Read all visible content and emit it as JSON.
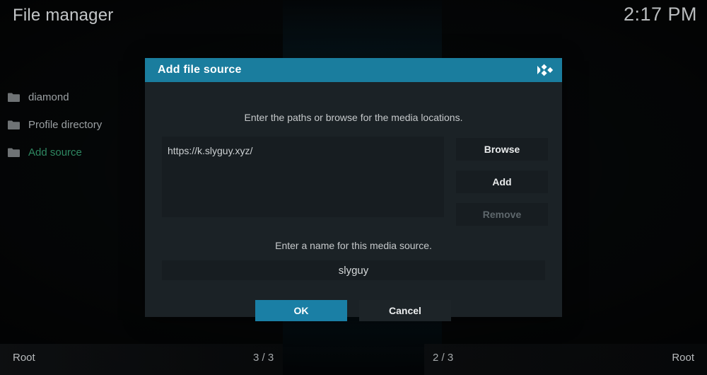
{
  "window": {
    "title": "File manager",
    "clock": "2:17 PM"
  },
  "sidebar": {
    "items": [
      {
        "label": "diamond",
        "icon": "folder-icon",
        "selected": false
      },
      {
        "label": "Profile directory",
        "icon": "folder-icon",
        "selected": false
      },
      {
        "label": "Add source",
        "icon": "folder-icon",
        "selected": true
      }
    ]
  },
  "status": {
    "left_path": "Root",
    "left_count": "3 / 3",
    "right_count": "2 / 3",
    "right_path": "Root"
  },
  "dialog": {
    "title": "Add file source",
    "logo_icon": "kodi-logo-icon",
    "paths_hint": "Enter the paths or browse for the media locations.",
    "path_entries": [
      "https://k.slyguy.xyz/"
    ],
    "buttons": {
      "browse": "Browse",
      "add": "Add",
      "remove": "Remove"
    },
    "name_hint": "Enter a name for this media source.",
    "name_value": "slyguy",
    "ok": "OK",
    "cancel": "Cancel"
  },
  "colors": {
    "accent_teal": "#1a7d9e",
    "ok_button_teal": "#1a7fa5",
    "selected_green": "#2e8761",
    "dialog_bg": "#1b2226",
    "field_bg": "#171d21",
    "disabled_text": "#5e676c"
  }
}
